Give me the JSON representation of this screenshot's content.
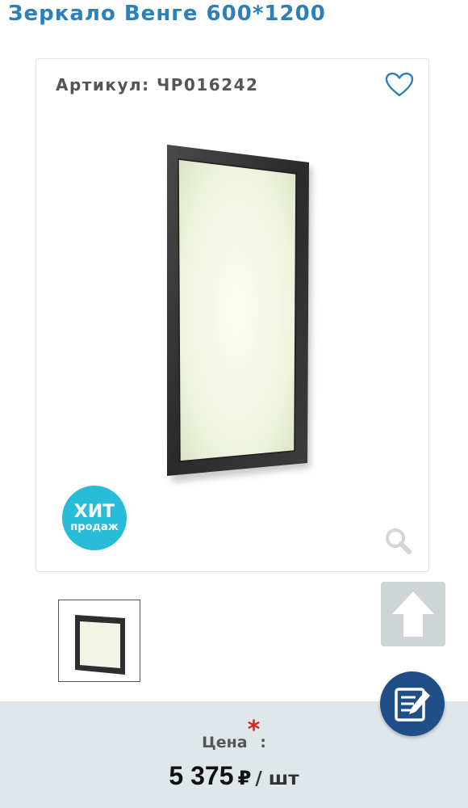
{
  "product": {
    "title": "Зеркало Венге 600*1200",
    "sku_label": "Артикул: ЧР016242"
  },
  "badge": {
    "line1": "ХИТ",
    "line2": "продаж"
  },
  "price": {
    "label": "Цена",
    "required_mark": "*",
    "colon": ":",
    "value": "5 375",
    "currency": "₽",
    "unit": "/ шт"
  },
  "icons": {
    "favorite": "heart-icon",
    "zoom": "magnifier-icon",
    "scroll_up": "arrow-up-icon",
    "feedback": "edit-document-icon"
  },
  "colors": {
    "title": "#2d7fb8",
    "badge": "#29bcd9",
    "price_panel": "#dfe7eb",
    "edit_button": "#1f4f86",
    "required_mark": "#e02020"
  }
}
